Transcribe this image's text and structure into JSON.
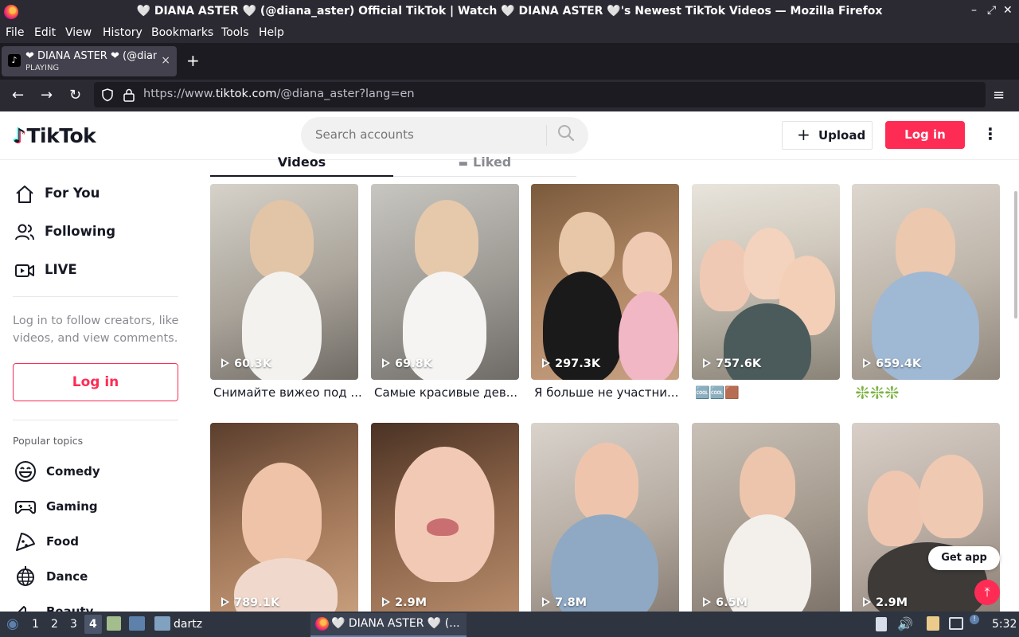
{
  "window": {
    "title": "🤍 DIANA ASTER 🤍 (@diana_aster) Official TikTok | Watch 🤍 DIANA ASTER 🤍's Newest TikTok Videos — Mozilla Firefox",
    "minimize": "–",
    "maximize": "⤢",
    "close": "✕"
  },
  "menu": [
    "File",
    "Edit",
    "View",
    "History",
    "Bookmarks",
    "Tools",
    "Help"
  ],
  "tab": {
    "title": "❤ DIANA ASTER ❤ (@diana_aster)",
    "status": "PLAYING",
    "close": "×",
    "new": "+"
  },
  "nav": {
    "url_prefix": "https://www.",
    "url_domain": "tiktok.com",
    "url_suffix": "/@diana_aster?lang=en"
  },
  "header": {
    "logo": "TikTok",
    "search_placeholder": "Search accounts",
    "upload": "Upload",
    "login": "Log in",
    "more": "⋮"
  },
  "sidebar": {
    "items": [
      {
        "label": "For You",
        "icon": "home-icon"
      },
      {
        "label": "Following",
        "icon": "users-icon"
      },
      {
        "label": "LIVE",
        "icon": "live-camera-icon"
      }
    ],
    "login_hint": "Log in to follow creators, like videos, and view comments.",
    "login_button": "Log in",
    "popular_heading": "Popular topics",
    "topics": [
      {
        "label": "Comedy",
        "icon": "smile-icon"
      },
      {
        "label": "Gaming",
        "icon": "gamepad-icon"
      },
      {
        "label": "Food",
        "icon": "pizza-icon"
      },
      {
        "label": "Dance",
        "icon": "globe-dance-icon"
      },
      {
        "label": "Beauty",
        "icon": "lipstick-icon"
      }
    ]
  },
  "tabs": {
    "videos": "Videos",
    "liked": "Liked"
  },
  "videos": [
    {
      "views": "60.3K",
      "caption": "Снимайте вижео под ..."
    },
    {
      "views": "69.8K",
      "caption": "Самые красивые дев..."
    },
    {
      "views": "297.3K",
      "caption": "Я больше не участни..."
    },
    {
      "views": "757.6K",
      "caption": "🆒🆒🟫"
    },
    {
      "views": "659.4K",
      "caption": "❇️❇️❇️"
    },
    {
      "views": "789.1K",
      "caption": ""
    },
    {
      "views": "2.9M",
      "caption": ""
    },
    {
      "views": "7.8M",
      "caption": ""
    },
    {
      "views": "6.5M",
      "caption": ""
    },
    {
      "views": "2.9M",
      "caption": ""
    }
  ],
  "get_app": "Get app",
  "taskbar": {
    "workspaces": [
      "1",
      "2",
      "3",
      "4"
    ],
    "folder": "dartz",
    "app": "🤍 DIANA ASTER 🤍 (...",
    "clock": "5:32"
  }
}
